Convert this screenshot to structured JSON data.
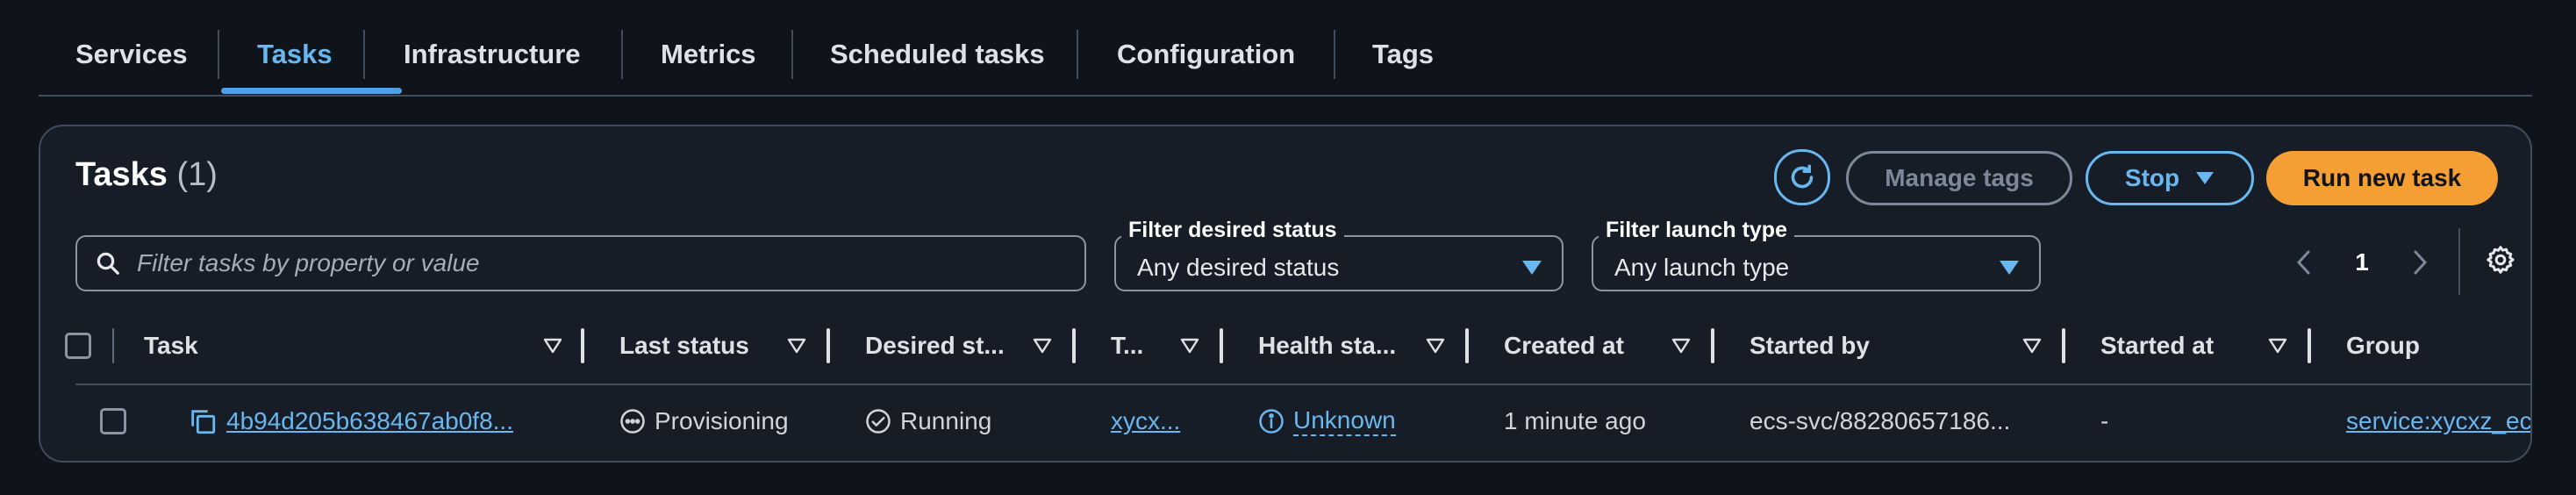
{
  "tabs": [
    {
      "label": "Services"
    },
    {
      "label": "Tasks"
    },
    {
      "label": "Infrastructure"
    },
    {
      "label": "Metrics"
    },
    {
      "label": "Scheduled tasks"
    },
    {
      "label": "Configuration"
    },
    {
      "label": "Tags"
    }
  ],
  "active_tab": "Tasks",
  "panel": {
    "title": "Tasks",
    "count": "(1)"
  },
  "buttons": {
    "refresh_icon": "refresh-icon",
    "manage_tags": "Manage tags",
    "stop": "Stop",
    "run_new_task": "Run new task"
  },
  "filters": {
    "search_placeholder": "Filter tasks by property or value",
    "desired_status_label": "Filter desired status",
    "desired_status_value": "Any desired status",
    "launch_type_label": "Filter launch type",
    "launch_type_value": "Any launch type"
  },
  "pagination": {
    "current_page": "1"
  },
  "table": {
    "columns": [
      "Task",
      "Last status",
      "Desired st...",
      "T...",
      "Health sta...",
      "Created at",
      "Started by",
      "Started at",
      "Group"
    ],
    "rows": [
      {
        "task": "4b94d205b638467ab0f8...",
        "last_status": "Provisioning",
        "desired_status": "Running",
        "type": "xycx...",
        "health_status": "Unknown",
        "created_at": "1 minute ago",
        "started_by": "ecs-svc/88280657186...",
        "started_at": "-",
        "group": "service:xycxz_ecs"
      }
    ]
  },
  "colors": {
    "accent_blue": "#69b7f0",
    "primary_orange": "#f59e34",
    "background": "#0f141a",
    "panel": "#161d26"
  }
}
